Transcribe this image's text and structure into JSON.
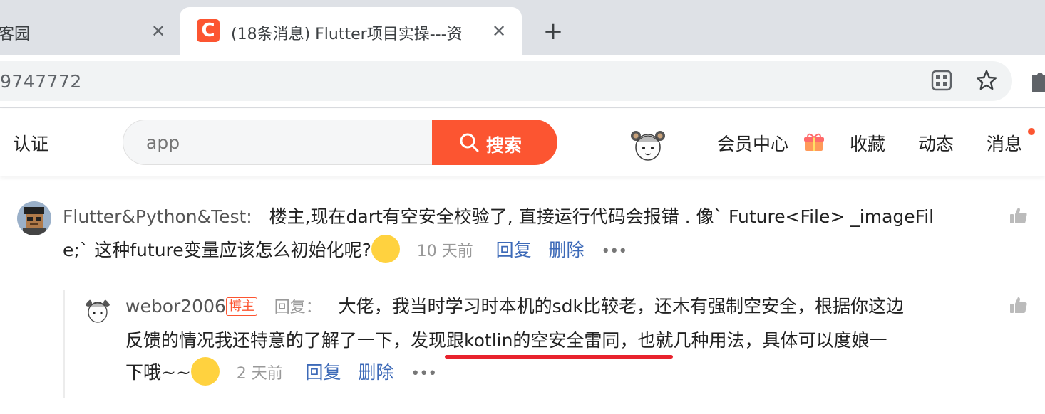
{
  "browser": {
    "tabs": [
      {
        "title": "客园",
        "active": false
      },
      {
        "title": "(18条消息) Flutter项目实操---资",
        "active": true,
        "favicon_letter": "C"
      }
    ],
    "url": "9747772",
    "new_tab_symbol": "+",
    "close_symbol": "✕"
  },
  "site": {
    "nav_left": "认证",
    "search": {
      "placeholder": "app",
      "button_label": "搜索"
    },
    "nav_items": [
      "会员中心",
      "收藏",
      "动态",
      "消息"
    ],
    "accent": "#fc5531"
  },
  "comments": [
    {
      "author": "Flutter&Python&Test:",
      "text_line1": "楼主,现在dart有空安全校验了, 直接运行代码会报错 . 像` Future<File> _imageFil",
      "text_line2": "e;` 这种future变量应该怎么初始化呢?",
      "time": "10 天前",
      "reply_label": "回复",
      "delete_label": "删除",
      "more": "•••"
    },
    {
      "author": "webor2006",
      "badge": "博主",
      "reply_to": "回复：",
      "text_line1": "大佬，我当时学习时本机的sdk比较老，还木有强制空安全，根据你这边",
      "text_line2_a": "反馈的情况我还特意的了解了一下，",
      "text_line2_highlight": "发现跟kotlin的空安全雷同",
      "text_line2_b": "，也就几种用法，具体可以度娘一",
      "text_line3": "下哦~~",
      "time": "2 天前",
      "reply_label": "回复",
      "delete_label": "删除",
      "more": "•••"
    }
  ]
}
